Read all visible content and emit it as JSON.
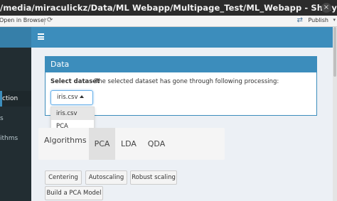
{
  "window": {
    "title": "/media/miraculickz/Data/ML Webapp/Multipage_Test/ML_Webapp - Shiny",
    "close_glyph": "×"
  },
  "toolbar": {
    "open_in_browser": "Open in Browser",
    "reload_glyph": "⟳",
    "publish_glyph": "⇄",
    "publish_label": "Publish",
    "menu_glyph": "▾"
  },
  "sidebar": {
    "items": [
      {
        "label": "ction",
        "active": true
      },
      {
        "label": "s",
        "active": false
      },
      {
        "label": "ithms",
        "active": false
      }
    ]
  },
  "navbar": {
    "toggle_icon": "hamburger"
  },
  "data_box": {
    "header": "Data",
    "select_label": "Select dataset",
    "processing_text": "The selected dataset has gone through following processing:",
    "selected_value": "iris.csv",
    "options": [
      "iris.csv",
      "PCA"
    ]
  },
  "tabs": {
    "label": "Algorithms",
    "items": [
      {
        "label": "PCA",
        "active": true
      },
      {
        "label": "LDA",
        "active": false
      },
      {
        "label": "QDA",
        "active": false
      }
    ]
  },
  "buttons": {
    "centering": "Centering",
    "autoscaling": "Autoscaling",
    "robust_scaling": "Robust scaling",
    "build_pca": "Build a PCA Model"
  },
  "colors": {
    "primary": "#3c8dbc",
    "navbar_dark": "#367fa9",
    "sidebar": "#222d32",
    "background": "#ecf0f5"
  }
}
